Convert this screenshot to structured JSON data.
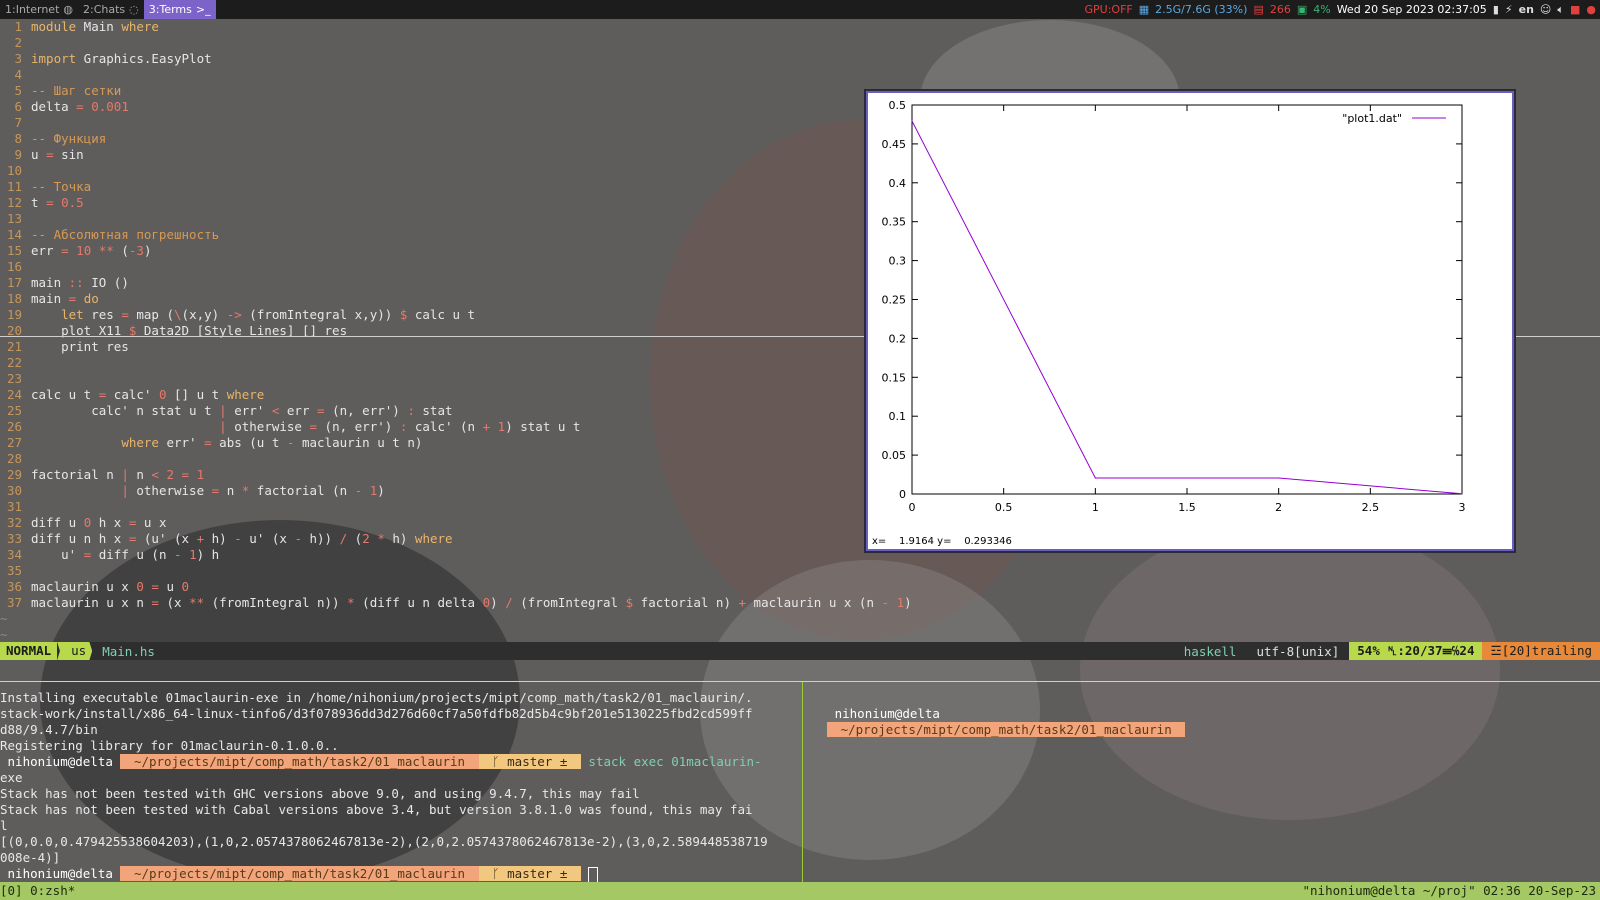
{
  "topbar": {
    "workspaces": [
      {
        "label": "1:Internet",
        "icon": "globe-icon",
        "active": false
      },
      {
        "label": "2:Chats",
        "icon": "chat-icon",
        "active": false
      },
      {
        "label": "3:Terms",
        "icon": "terminal-icon",
        "active": true
      }
    ],
    "gpu": "GPU:OFF",
    "memory": "2.5G/7.6G (33%)",
    "rootfs": "266",
    "cpu": "4%",
    "datetime": "Wed 20 Sep 2023 02:37:05",
    "layout": "en"
  },
  "editor": {
    "lines": [
      {
        "n": "1",
        "html": "<span class='kw'>module</span> Main <span class='kw'>where</span>"
      },
      {
        "n": "2",
        "html": ""
      },
      {
        "n": "3",
        "html": "<span class='kw'>import</span> Graphics.EasyPlot"
      },
      {
        "n": "4",
        "html": ""
      },
      {
        "n": "5",
        "html": "<span class='cm'>-- Шаг сетки</span>"
      },
      {
        "n": "6",
        "html": "delta <span class='op'>=</span> <span class='num'>0.001</span>"
      },
      {
        "n": "7",
        "html": ""
      },
      {
        "n": "8",
        "html": "<span class='cm'>-- Функция</span>"
      },
      {
        "n": "9",
        "html": "u <span class='op'>=</span> sin"
      },
      {
        "n": "10",
        "html": ""
      },
      {
        "n": "11",
        "html": "<span class='cm'>-- Точка</span>"
      },
      {
        "n": "12",
        "html": "t <span class='op'>=</span> <span class='num'>0.5</span>"
      },
      {
        "n": "13",
        "html": ""
      },
      {
        "n": "14",
        "html": "<span class='cm'>-- Абсолютная погрешность</span>"
      },
      {
        "n": "15",
        "html": "err <span class='op'>=</span> <span class='num'>10</span> <span class='op'>**</span> (<span class='op'>-</span><span class='num'>3</span>)"
      },
      {
        "n": "16",
        "html": ""
      },
      {
        "n": "17",
        "html": "main <span class='op'>::</span> IO ()"
      },
      {
        "n": "18",
        "html": "main <span class='op'>=</span> <span class='kw'>do</span>"
      },
      {
        "n": "19",
        "html": "    <span class='kw'>let</span> res <span class='op'>=</span> map (<span class='op'>\\</span>(x,y) <span class='op'>-&gt;</span> (fromIntegral x,y)) <span class='op'>$</span> calc u t"
      },
      {
        "n": "20",
        "html": "    plot X11 <span class='op'>$</span> Data2D [Style Lines] [] res"
      },
      {
        "n": "21",
        "html": "    print res"
      },
      {
        "n": "22",
        "html": ""
      },
      {
        "n": "23",
        "html": ""
      },
      {
        "n": "24",
        "html": "calc u t <span class='op'>=</span> calc' <span class='num'>0</span> [] u t <span class='kw'>where</span>"
      },
      {
        "n": "25",
        "html": "        calc' n stat u t <span class='op'>|</span> err' <span class='op'>&lt;</span> err <span class='op'>=</span> (n, err') <span class='op'>:</span> stat"
      },
      {
        "n": "26",
        "html": "                         <span class='op'>|</span> otherwise <span class='op'>=</span> (n, err') <span class='op'>:</span> calc' (n <span class='op'>+</span> <span class='num'>1</span>) stat u t"
      },
      {
        "n": "27",
        "html": "            <span class='kw'>where</span> err' <span class='op'>=</span> abs (u t <span class='op'>-</span> maclaurin u t n)"
      },
      {
        "n": "28",
        "html": ""
      },
      {
        "n": "29",
        "html": "factorial n <span class='op'>|</span> n <span class='op'>&lt;</span> <span class='num'>2</span> <span class='op'>=</span> <span class='num'>1</span>"
      },
      {
        "n": "30",
        "html": "            <span class='op'>|</span> otherwise <span class='op'>=</span> n <span class='op'>*</span> factorial (n <span class='op'>-</span> <span class='num'>1</span>)"
      },
      {
        "n": "31",
        "html": ""
      },
      {
        "n": "32",
        "html": "diff u <span class='num'>0</span> h x <span class='op'>=</span> u x"
      },
      {
        "n": "33",
        "html": "diff u n h x <span class='op'>=</span> (u' (x <span class='op'>+</span> h) <span class='op'>-</span> u' (x <span class='op'>-</span> h)) <span class='op'>/</span> (<span class='num'>2</span> <span class='op'>*</span> h) <span class='kw'>where</span>"
      },
      {
        "n": "34",
        "html": "    u' <span class='op'>=</span> diff u (n <span class='op'>-</span> <span class='num'>1</span>) h"
      },
      {
        "n": "35",
        "html": ""
      },
      {
        "n": "36",
        "html": "maclaurin u x <span class='num'>0</span> <span class='op'>=</span> u <span class='num'>0</span>"
      },
      {
        "n": "37",
        "html": "maclaurin u x n <span class='op'>=</span> (x <span class='op'>**</span> (fromIntegral n)) <span class='op'>*</span> (diff u n delta <span class='num'>0</span>) <span class='op'>/</span> (fromIntegral <span class='op'>$</span> factorial n) <span class='op'>+</span> maclaurin u x (n <span class='op'>-</span> <span class='num'>1</span>)"
      }
    ],
    "tildes": [
      "~",
      "~"
    ]
  },
  "statusline": {
    "mode": "NORMAL",
    "keymap": "us",
    "filename": "Main.hs",
    "filetype": "haskell",
    "encoding": "utf-8[unix]",
    "percent": "54%",
    "position": "␤:20/37☰℅24",
    "trailing": "☲[20]trailing"
  },
  "terminal_left": {
    "lines": [
      "Installing executable 01maclaurin-exe in /home/nihonium/projects/mipt/comp_math/task2/01_maclaurin/.",
      "stack-work/install/x86_64-linux-tinfo6/d3f078936dd3d276d60cf7a50fdfb82d5b4c9bf201e5130225fbd2cd599ff",
      "d88/9.4.7/bin",
      "Registering library for 01maclaurin-0.1.0.0..",
      "",
      "exe",
      "Stack has not been tested with GHC versions above 9.0, and using 9.4.7, this may fail",
      "Stack has not been tested with Cabal versions above 3.4, but version 3.8.1.0 was found, this may fai",
      "l",
      "[(0,0.0,0.479425538604203),(1,0,2.0574378062467813e-2),(2,0,2.0574378062467813e-2),(3,0,2.589448538719",
      "008e-4)]"
    ],
    "prompt_user": " nihonium@delta ",
    "prompt_path": " ~/projects/mipt/comp_math/task2/01_maclaurin ",
    "prompt_git": " ᚴ master ± ",
    "command": "stack exec 01maclaurin-"
  },
  "terminal_right": {
    "prompt_user": " nihonium@delta ",
    "prompt_path": " ~/projects/mipt/comp_math/task2/01_maclaurin "
  },
  "tmux": {
    "left": "[0] 0:zsh*",
    "right": "\"nihonium@delta ~/proj\" 02:36 20-Sep-23"
  },
  "gnuplot": {
    "status": "x=    1.9164 y=    0.293346"
  },
  "chart_data": {
    "type": "line",
    "x": [
      0,
      1,
      2,
      3
    ],
    "series": [
      {
        "name": "\"plot1.dat\"",
        "values": [
          0.479425538604203,
          0.020574378062467813,
          0.020574378062467813,
          0.0002589448538719008
        ],
        "color": "#9400d3"
      }
    ],
    "xlim": [
      0,
      3
    ],
    "ylim": [
      0,
      0.5
    ],
    "xticks": [
      "0",
      "0.5",
      "1",
      "1.5",
      "2",
      "2.5",
      "3"
    ],
    "yticks": [
      "0",
      "0.05",
      "0.1",
      "0.15",
      "0.2",
      "0.25",
      "0.3",
      "0.35",
      "0.4",
      "0.45",
      "0.5"
    ],
    "legend": "top-right",
    "grid": false
  }
}
